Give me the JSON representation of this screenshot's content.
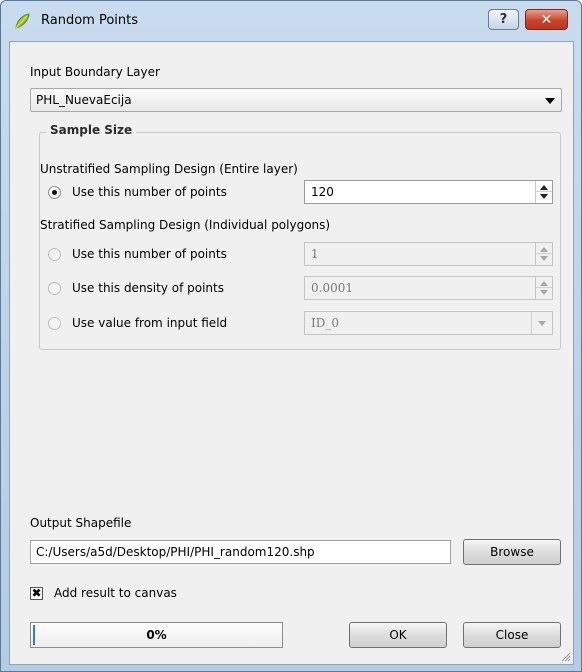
{
  "window": {
    "title": "Random Points",
    "help_label": "?",
    "close_label": "✕"
  },
  "input": {
    "label": "Input Boundary Layer",
    "value": "PHL_NuevaEcija"
  },
  "sample": {
    "group_title": "Sample Size",
    "unstratified_heading": "Unstratified Sampling Design (Entire layer)",
    "unstratified_points_label": "Use this number of points",
    "unstratified_points_value": "120",
    "stratified_heading": "Stratified Sampling Design (Individual polygons)",
    "stratified_points_label": "Use this number of points",
    "stratified_points_value": "1",
    "density_label": "Use this density of points",
    "density_value": "0.0001",
    "field_label": "Use value from input field",
    "field_value": "ID_0"
  },
  "output": {
    "label": "Output Shapefile",
    "path": "C:/Users/a5d/Desktop/PHI/PHI_random120.shp",
    "browse_label": "Browse",
    "add_canvas_label": "Add result to canvas",
    "add_canvas_checked": true
  },
  "footer": {
    "progress_text": "0%",
    "progress_value": 0,
    "ok_label": "OK",
    "close_label": "Close"
  }
}
